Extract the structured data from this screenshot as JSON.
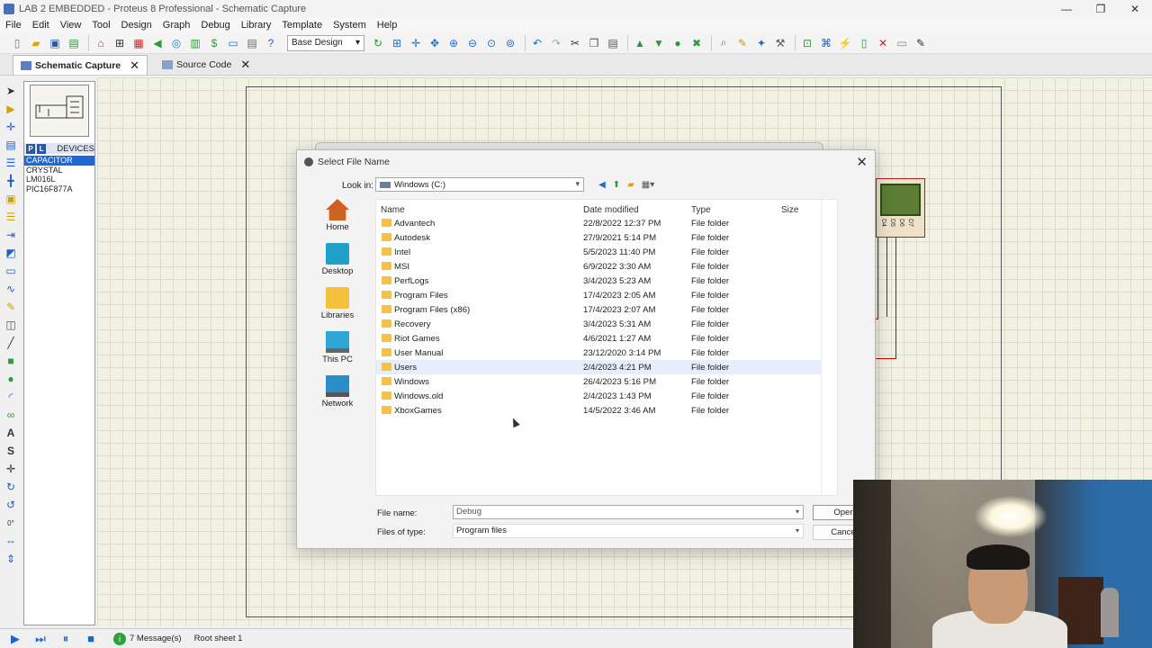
{
  "window": {
    "title": "LAB 2 EMBEDDED - Proteus 8 Professional - Schematic Capture",
    "controls": [
      "—",
      "❐",
      "✕"
    ]
  },
  "menu": [
    "File",
    "Edit",
    "View",
    "Tool",
    "Design",
    "Graph",
    "Debug",
    "Library",
    "Template",
    "System",
    "Help"
  ],
  "toolbar": {
    "design_select": "Base Design",
    "icons": [
      "new-file-icon",
      "open-folder-icon",
      "save-icon",
      "import-icon",
      "home-icon",
      "schematic-icon",
      "pcb-icon",
      "gerber-icon",
      "3d-icon",
      "bom-icon",
      "source-icon",
      "simulation-icon",
      "notes-icon",
      "help-icon"
    ],
    "right_icons": [
      "refresh-icon",
      "grid-icon",
      "origin-icon",
      "pan-icon",
      "zoom-in-icon",
      "zoom-out-icon",
      "zoom-all-icon",
      "zoom-area-icon",
      "undo-icon",
      "redo-icon",
      "cut-icon",
      "copy-icon",
      "paste-icon",
      "block-copy-icon",
      "block-move-icon",
      "block-rotate-icon",
      "block-delete-icon",
      "pick-device-icon",
      "make-device-icon",
      "package-tool-icon",
      "decompose-icon",
      "wire-autorouter-icon",
      "search-tag-icon",
      "property-assign-icon",
      "new-sheet-icon",
      "remove-sheet-icon",
      "exit-sheet-icon",
      "design-explorer-icon"
    ]
  },
  "tabs": [
    {
      "label": "Schematic Capture",
      "active": true
    },
    {
      "label": "Source Code",
      "active": false
    }
  ],
  "devices": {
    "p_button": "P",
    "l_button": "L",
    "title": "DEVICES",
    "items": [
      "CAPACITOR",
      "CRYSTAL",
      "LM016L",
      "PIC16F877A"
    ],
    "selected_index": 0
  },
  "lcd": {
    "pins": [
      "D4",
      "D5",
      "D6",
      "D7"
    ]
  },
  "dialog": {
    "title": "Select File Name",
    "look_in_label": "Look in:",
    "look_in_value": "Windows (C:)",
    "places": [
      "Home",
      "Desktop",
      "Libraries",
      "This PC",
      "Network"
    ],
    "columns": {
      "name": "Name",
      "date": "Date modified",
      "type": "Type",
      "size": "Size"
    },
    "files": [
      {
        "name": "Advantech",
        "date": "22/8/2022 12:37 PM",
        "type": "File folder"
      },
      {
        "name": "Autodesk",
        "date": "27/9/2021 5:14 PM",
        "type": "File folder"
      },
      {
        "name": "Intel",
        "date": "5/5/2023 11:40 PM",
        "type": "File folder"
      },
      {
        "name": "MSI",
        "date": "6/9/2022 3:30 AM",
        "type": "File folder"
      },
      {
        "name": "PerfLogs",
        "date": "3/4/2023 5:23 AM",
        "type": "File folder"
      },
      {
        "name": "Program Files",
        "date": "17/4/2023 2:05 AM",
        "type": "File folder"
      },
      {
        "name": "Program Files (x86)",
        "date": "17/4/2023 2:07 AM",
        "type": "File folder"
      },
      {
        "name": "Recovery",
        "date": "3/4/2023 5:31 AM",
        "type": "File folder"
      },
      {
        "name": "Riot Games",
        "date": "4/6/2021 1:27 AM",
        "type": "File folder"
      },
      {
        "name": "User Manual",
        "date": "23/12/2020 3:14 PM",
        "type": "File folder"
      },
      {
        "name": "Users",
        "date": "2/4/2023 4:21 PM",
        "type": "File folder"
      },
      {
        "name": "Windows",
        "date": "26/4/2023 5:16 PM",
        "type": "File folder"
      },
      {
        "name": "Windows.old",
        "date": "2/4/2023 1:43 PM",
        "type": "File folder"
      },
      {
        "name": "XboxGames",
        "date": "14/5/2022 3:46 AM",
        "type": "File folder"
      }
    ],
    "hover_index": 10,
    "file_name_label": "File name:",
    "file_name_value": "Debug",
    "file_type_label": "Files of type:",
    "file_type_value": "Program files",
    "open_label": "Open",
    "cancel_label": "Cancel"
  },
  "status": {
    "messages": "7 Message(s)",
    "sheet": "Root sheet 1",
    "info_glyph": "i"
  },
  "left_rotation_value": "0°"
}
